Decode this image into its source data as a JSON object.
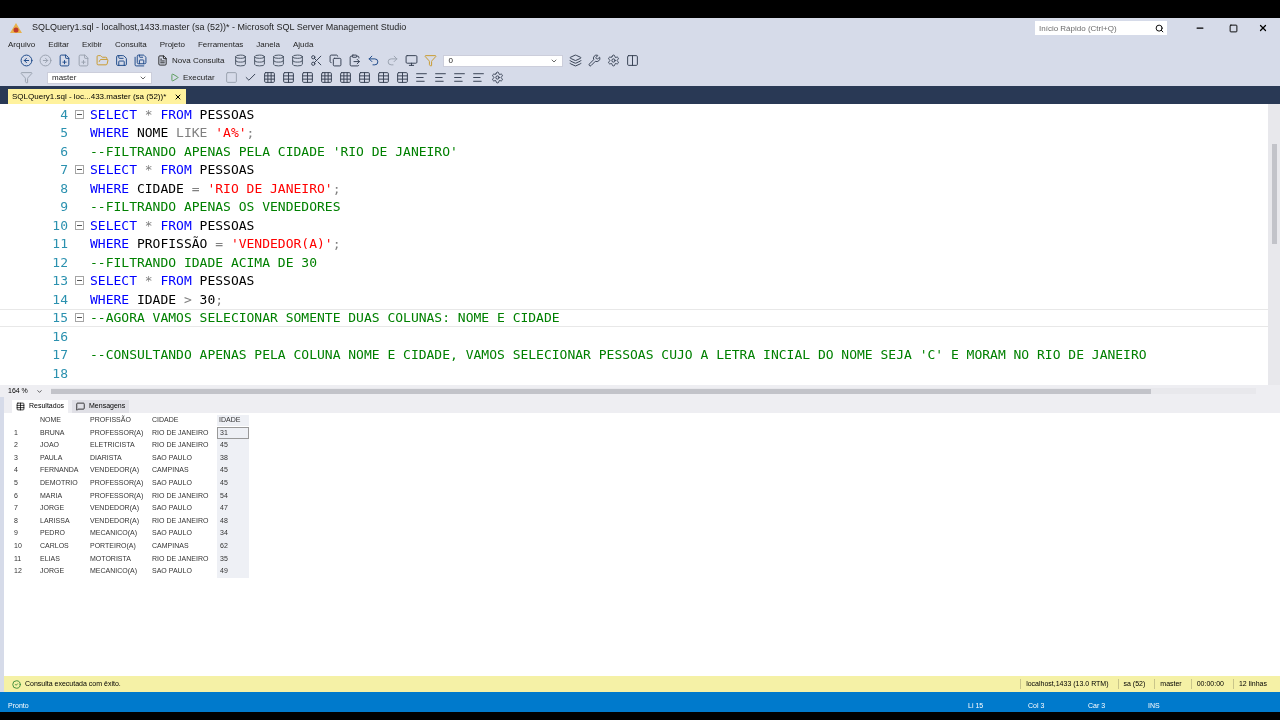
{
  "window": {
    "title": "SQLQuery1.sql - localhost,1433.master (sa (52))* - Microsoft SQL Server Management Studio",
    "quick_launch": {
      "placeholder": "Início Rápido (Ctrl+Q)"
    }
  },
  "menu": [
    "Arquivo",
    "Editar",
    "Exibir",
    "Consulta",
    "Projeto",
    "Ferramentas",
    "Janela",
    "Ajuda"
  ],
  "toolbar": {
    "new_query": "Nova Consulta",
    "config_value": "0",
    "database": "master",
    "execute": "Executar"
  },
  "document_tab": {
    "label": "SQLQuery1.sql - loc...433.master (sa (52))*",
    "selected": true
  },
  "editor": {
    "zoom": "164 %",
    "lines": [
      {
        "number": "4",
        "fold": true,
        "segments": [
          {
            "kind": "keyword",
            "text": "SELECT"
          },
          {
            "kind": "operator",
            "text": " * "
          },
          {
            "kind": "keyword",
            "text": "FROM"
          },
          {
            "kind": "plain",
            "text": " PESSOAS"
          }
        ]
      },
      {
        "number": "5",
        "fold": false,
        "segments": [
          {
            "kind": "keyword",
            "text": "WHERE"
          },
          {
            "kind": "plain",
            "text": " NOME "
          },
          {
            "kind": "operator",
            "text": "LIKE "
          },
          {
            "kind": "string",
            "text": "'A%'"
          },
          {
            "kind": "operator",
            "text": ";"
          }
        ]
      },
      {
        "number": "6",
        "fold": false,
        "segments": [
          {
            "kind": "comment",
            "text": "--FILTRANDO APENAS PELA CIDADE 'RIO DE JANEIRO'"
          }
        ]
      },
      {
        "number": "7",
        "fold": true,
        "segments": [
          {
            "kind": "keyword",
            "text": "SELECT"
          },
          {
            "kind": "operator",
            "text": " * "
          },
          {
            "kind": "keyword",
            "text": "FROM"
          },
          {
            "kind": "plain",
            "text": " PESSOAS"
          }
        ]
      },
      {
        "number": "8",
        "fold": false,
        "segments": [
          {
            "kind": "keyword",
            "text": "WHERE"
          },
          {
            "kind": "plain",
            "text": " CIDADE "
          },
          {
            "kind": "operator",
            "text": "= "
          },
          {
            "kind": "string",
            "text": "'RIO DE JANEIRO'"
          },
          {
            "kind": "operator",
            "text": ";"
          }
        ]
      },
      {
        "number": "9",
        "fold": false,
        "segments": [
          {
            "kind": "comment",
            "text": "--FILTRANDO APENAS OS VENDEDORES"
          }
        ]
      },
      {
        "number": "10",
        "fold": true,
        "segments": [
          {
            "kind": "keyword",
            "text": "SELECT"
          },
          {
            "kind": "operator",
            "text": " * "
          },
          {
            "kind": "keyword",
            "text": "FROM"
          },
          {
            "kind": "plain",
            "text": " PESSOAS"
          }
        ]
      },
      {
        "number": "11",
        "fold": false,
        "segments": [
          {
            "kind": "keyword",
            "text": "WHERE"
          },
          {
            "kind": "plain",
            "text": " PROFISSÃO "
          },
          {
            "kind": "operator",
            "text": "= "
          },
          {
            "kind": "string",
            "text": "'VENDEDOR(A)'"
          },
          {
            "kind": "operator",
            "text": ";"
          }
        ]
      },
      {
        "number": "12",
        "fold": false,
        "segments": [
          {
            "kind": "comment",
            "text": "--FILTRANDO IDADE ACIMA DE 30"
          }
        ]
      },
      {
        "number": "13",
        "fold": true,
        "segments": [
          {
            "kind": "keyword",
            "text": "SELECT"
          },
          {
            "kind": "operator",
            "text": " * "
          },
          {
            "kind": "keyword",
            "text": "FROM"
          },
          {
            "kind": "plain",
            "text": " PESSOAS"
          }
        ]
      },
      {
        "number": "14",
        "fold": false,
        "segments": [
          {
            "kind": "keyword",
            "text": "WHERE"
          },
          {
            "kind": "plain",
            "text": " IDADE "
          },
          {
            "kind": "operator",
            "text": ">"
          },
          {
            "kind": "plain",
            "text": " 30"
          },
          {
            "kind": "operator",
            "text": ";"
          }
        ]
      },
      {
        "number": "15",
        "fold": true,
        "current": true,
        "segments": [
          {
            "kind": "comment",
            "text": "--AGORA VAMOS SELECIONAR SOMENTE DUAS COLUNAS: NOME E CIDADE"
          }
        ]
      },
      {
        "number": "16",
        "fold": false
      },
      {
        "number": "17",
        "fold": false,
        "segments": [
          {
            "kind": "comment",
            "text": "--CONSULTANDO APENAS PELA COLUNA NOME E CIDADE, VAMOS SELECIONAR PESSOAS CUJO A LETRA INCIAL DO NOME SEJA 'C' E MORAM NO RIO DE JANEIRO"
          }
        ]
      },
      {
        "number": "18",
        "fold": false
      }
    ]
  },
  "results": {
    "tabs": [
      {
        "label": "Resultados",
        "selected": true
      },
      {
        "label": "Mensagens",
        "selected": false
      }
    ],
    "columns": [
      {
        "label": "NOME",
        "selected": false
      },
      {
        "label": "PROFISSÃO",
        "selected": false
      },
      {
        "label": "CIDADE",
        "selected": false
      },
      {
        "label": "IDADE",
        "selected": true
      }
    ],
    "rows": [
      {
        "number": "1",
        "focused": true,
        "cells": [
          "BRUNA",
          "PROFESSOR(A)",
          "RIO DE JANEIRO",
          "31"
        ]
      },
      {
        "number": "2",
        "focused": false,
        "cells": [
          "JOAO",
          "ELETRICISTA",
          "RIO DE JANEIRO",
          "45"
        ]
      },
      {
        "number": "3",
        "focused": false,
        "cells": [
          "PAULA",
          "DIARISTA",
          "SAO PAULO",
          "38"
        ]
      },
      {
        "number": "4",
        "focused": false,
        "cells": [
          "FERNANDA",
          "VENDEDOR(A)",
          "CAMPINAS",
          "45"
        ]
      },
      {
        "number": "5",
        "focused": false,
        "cells": [
          "DEMOTRIO",
          "PROFESSOR(A)",
          "SAO PAULO",
          "45"
        ]
      },
      {
        "number": "6",
        "focused": false,
        "cells": [
          "MARIA",
          "PROFESSOR(A)",
          "RIO DE JANEIRO",
          "54"
        ]
      },
      {
        "number": "7",
        "focused": false,
        "cells": [
          "JORGE",
          "VENDEDOR(A)",
          "SAO PAULO",
          "47"
        ]
      },
      {
        "number": "8",
        "focused": false,
        "cells": [
          "LARISSA",
          "VENDEDOR(A)",
          "RIO DE JANEIRO",
          "48"
        ]
      },
      {
        "number": "9",
        "focused": false,
        "cells": [
          "PEDRO",
          "MECANICO(A)",
          "SAO PAULO",
          "34"
        ]
      },
      {
        "number": "10",
        "focused": false,
        "cells": [
          "CARLOS",
          "PORTEIRO(A)",
          "CAMPINAS",
          "62"
        ]
      },
      {
        "number": "11",
        "focused": false,
        "cells": [
          "ELIAS",
          "MOTORISTA",
          "RIO DE JANEIRO",
          "35"
        ]
      },
      {
        "number": "12",
        "focused": false,
        "cells": [
          "JORGE",
          "MECANICO(A)",
          "SAO PAULO",
          "49"
        ]
      }
    ]
  },
  "query_status": {
    "message": "Consulta executada com êxito.",
    "items": [
      "localhost,1433 (13.0 RTM)",
      "sa (52)",
      "master",
      "00:00:00",
      "12 linhas"
    ]
  },
  "status_bar": {
    "state": "Pronto",
    "items": [
      "Li 15",
      "Col 3",
      "Car 3",
      "INS"
    ]
  }
}
